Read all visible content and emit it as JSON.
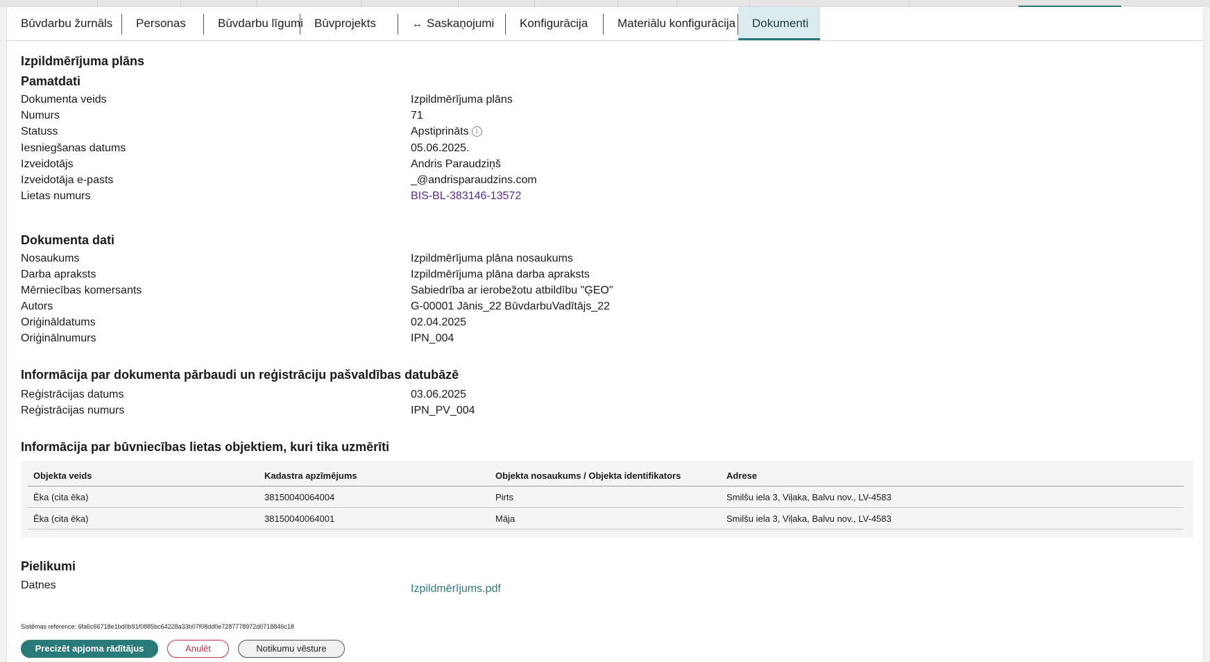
{
  "tabs": [
    {
      "label": "Būvdarbu žurnāls",
      "active": false
    },
    {
      "label": "Personas",
      "active": false
    },
    {
      "label": "Būvdarbu līgumi",
      "active": false
    },
    {
      "label": "Būvprojekts",
      "active": false
    },
    {
      "label": "Saskaņojumi",
      "icon": "arrows-horizontal-icon",
      "active": false
    },
    {
      "label": "Konfigurācija",
      "active": false
    },
    {
      "label": "Materiālu konfigurācija",
      "active": false
    },
    {
      "label": "Dokumenti",
      "active": true
    }
  ],
  "page_title": "Izpildmērījuma plāns",
  "pamatdati": {
    "title": "Pamatdati",
    "rows": [
      {
        "label": "Dokumenta veids",
        "value": "Izpildmērījuma plāns"
      },
      {
        "label": "Numurs",
        "value": "71"
      },
      {
        "label": "Statuss",
        "value": "Apstiprināts"
      },
      {
        "label": "Iesniegšanas datums",
        "value": "05.06.2025."
      },
      {
        "label": "Izveidotājs",
        "value": "Andris Paraudziņš"
      },
      {
        "label": "Izveidotāja e-pasts",
        "value": "_@andrisparaudzins.com"
      },
      {
        "label": "Lietas numurs",
        "value": "BIS-BL-383146-13572"
      }
    ]
  },
  "dokumenta_dati": {
    "title": "Dokumenta dati",
    "rows": [
      {
        "label": "Nosaukums",
        "value": "Izpildmērījuma plāna nosaukums"
      },
      {
        "label": "Darba apraksts",
        "value": "Izpildmērījuma plāna darba apraksts"
      },
      {
        "label": "Mērniecības komersants",
        "value": "Sabiedrība ar ierobežotu atbildību \"ĢEO\""
      },
      {
        "label": "Autors",
        "value": "G-00001 Jānis_22 BūvdarbuVadītājs_22"
      },
      {
        "label": "Oriģināldatums",
        "value": "02.04.2025"
      },
      {
        "label": "Oriģinālnumurs",
        "value": "IPN_004"
      }
    ]
  },
  "registracija": {
    "title": "Informācija par dokumenta pārbaudi un reģistrāciju pašvaldības datubāzē",
    "rows": [
      {
        "label": "Reģistrācijas datums",
        "value": "03.06.2025"
      },
      {
        "label": "Reģistrācijas numurs",
        "value": "IPN_PV_004"
      }
    ]
  },
  "objekti": {
    "title": "Informācija par būvniecības lietas objektiem, kuri tika uzmērīti",
    "columns": [
      "Objekta veids",
      "Kadastra apzīmējums",
      "Objekta nosaukums / Objekta identifikators",
      "Adrese"
    ],
    "rows": [
      [
        "Ēka (cita ēka)",
        "38150040064004",
        "Pirts",
        "Smilšu iela 3, Viļaka, Balvu nov., LV-4583"
      ],
      [
        "Ēka (cita ēka)",
        "38150040064001",
        "Māja",
        "Smilšu iela 3, Viļaka, Balvu nov., LV-4583"
      ]
    ]
  },
  "pielikumi": {
    "title": "Pielikumi",
    "label": "Datnes",
    "file": "Izpildmērījums.pdf"
  },
  "system_reference": "Sistēmas reference: 6fa6c66718e1bd0b91f0885bc64228a33b07f08dd0e7287778972d0718846c18",
  "buttons": {
    "primary": "Precizēt apjoma rādītājus",
    "cancel": "Anulēt",
    "history": "Notikumu vēsture"
  },
  "colors": {
    "accent": "#2b7a7a",
    "link": "#5b2a8c",
    "danger": "#c0304a",
    "active_tab_bg": "#dcecee"
  }
}
